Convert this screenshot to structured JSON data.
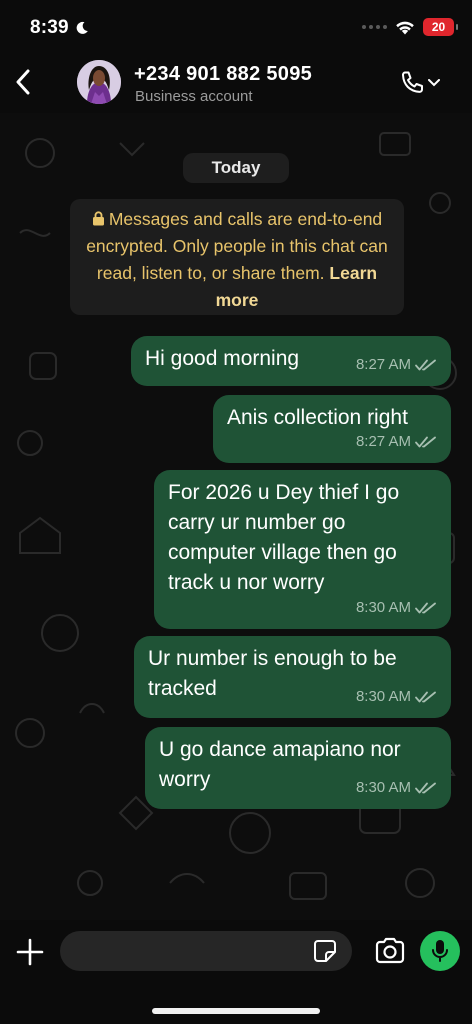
{
  "status_bar": {
    "time": "8:39",
    "battery": "20"
  },
  "header": {
    "contact_name": "+234 901 882 5095",
    "subtitle": "Business account"
  },
  "chat": {
    "date_label": "Today",
    "encryption_notice": "Messages and calls are end-to-end encrypted. Only people in this chat can read, listen to, or share them.",
    "learn_more": "Learn more",
    "messages": [
      {
        "text": "Hi good morning",
        "time": "8:27 AM",
        "status": "read"
      },
      {
        "text": "Anis collection right",
        "time": "8:27 AM",
        "status": "read"
      },
      {
        "text": "For 2026 u Dey thief I go carry ur number go computer village then go track u nor worry",
        "time": "8:30 AM",
        "status": "read"
      },
      {
        "text": "Ur number is enough to be tracked",
        "time": "8:30 AM",
        "status": "read"
      },
      {
        "text": "U go dance amapiano nor worry",
        "time": "8:30 AM",
        "status": "read"
      }
    ]
  },
  "input": {
    "placeholder": ""
  },
  "colors": {
    "outgoing_bubble": "#1f5336",
    "mic_button": "#25c05d",
    "encryption_text": "#e8c46b",
    "battery": "#e0262d"
  },
  "icons": [
    "back-icon",
    "phone-icon",
    "chevron-down-icon",
    "lock-icon",
    "double-check-icon",
    "plus-icon",
    "sticker-icon",
    "camera-icon",
    "mic-icon",
    "wifi-icon",
    "moon-icon"
  ]
}
